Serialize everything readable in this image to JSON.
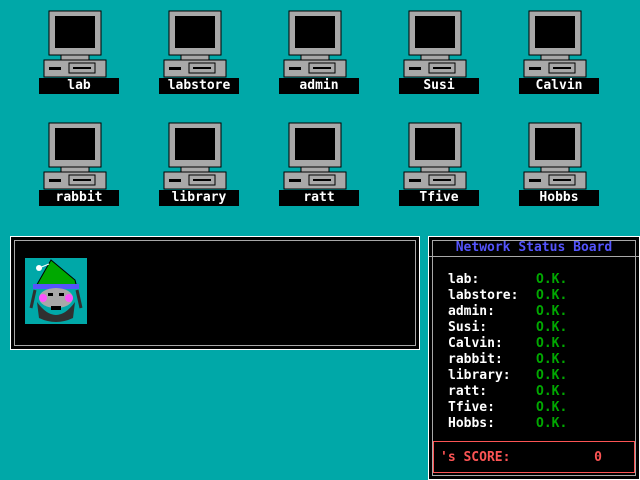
{
  "computers": [
    {
      "name": "lab"
    },
    {
      "name": "labstore"
    },
    {
      "name": "admin"
    },
    {
      "name": "Susi"
    },
    {
      "name": "Calvin"
    },
    {
      "name": "rabbit"
    },
    {
      "name": "library"
    },
    {
      "name": "ratt"
    },
    {
      "name": "Tfive"
    },
    {
      "name": "Hobbs"
    }
  ],
  "status_board": {
    "title": "Network Status Board",
    "rows": [
      {
        "host": "lab:",
        "status": "O.K."
      },
      {
        "host": "labstore:",
        "status": "O.K."
      },
      {
        "host": "admin:",
        "status": "O.K."
      },
      {
        "host": "Susi:",
        "status": "O.K."
      },
      {
        "host": "Calvin:",
        "status": "O.K."
      },
      {
        "host": "rabbit:",
        "status": "O.K."
      },
      {
        "host": "library:",
        "status": "O.K."
      },
      {
        "host": "ratt:",
        "status": "O.K."
      },
      {
        "host": "Tfive:",
        "status": "O.K."
      },
      {
        "host": "Hobbs:",
        "status": "O.K."
      }
    ],
    "score_label": "'s SCORE:",
    "score_value": "0"
  },
  "colors": {
    "background": "#00a8a8",
    "status_ok": "#00a800",
    "title_blue": "#5454fc",
    "score_red": "#fc5454"
  },
  "icons": {
    "computer": "desktop-computer-icon",
    "portrait": "wizard-portrait-icon"
  }
}
